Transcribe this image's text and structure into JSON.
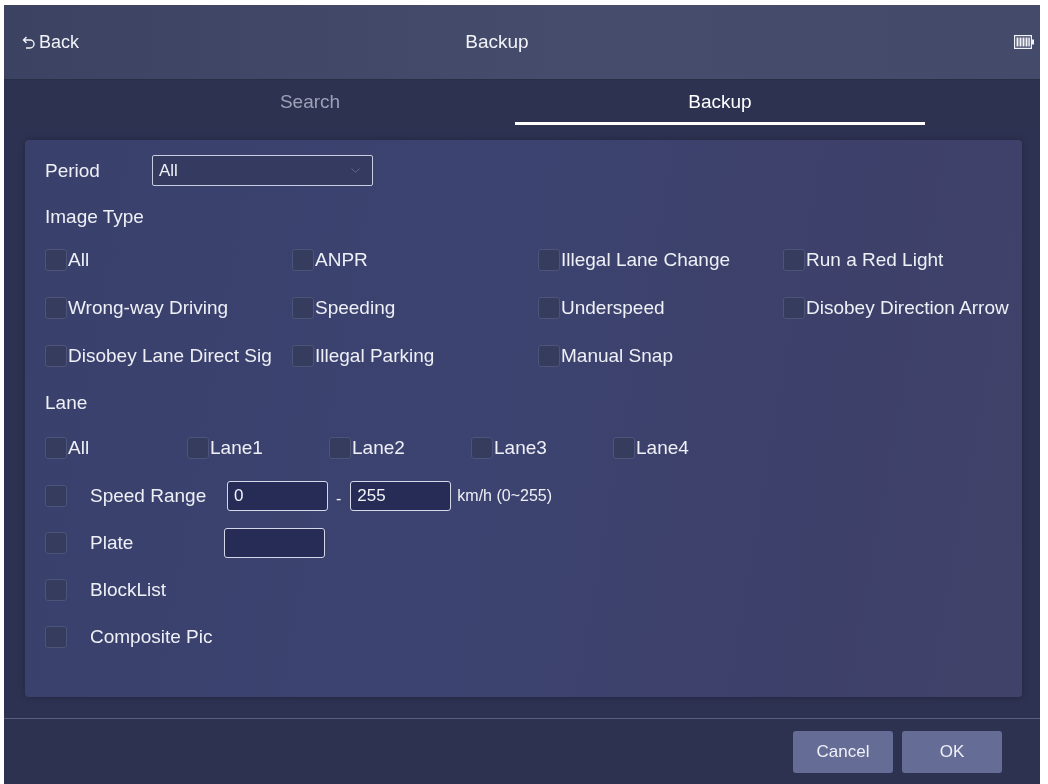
{
  "header": {
    "back_label": "Back",
    "title": "Backup"
  },
  "tabs": [
    {
      "label": "Search",
      "selected": false
    },
    {
      "label": "Backup",
      "selected": true
    }
  ],
  "period": {
    "label": "Period",
    "value": "All"
  },
  "image_type": {
    "label": "Image Type",
    "options": [
      {
        "label": "All",
        "checked": false
      },
      {
        "label": "ANPR",
        "checked": false
      },
      {
        "label": "Illegal Lane Change",
        "checked": false
      },
      {
        "label": "Run a Red Light",
        "checked": false
      },
      {
        "label": "Wrong-way Driving",
        "checked": false
      },
      {
        "label": "Speeding",
        "checked": false
      },
      {
        "label": "Underspeed",
        "checked": false
      },
      {
        "label": "Disobey Direction Arrow",
        "checked": false
      },
      {
        "label": "Disobey Lane Direct Sig",
        "checked": false
      },
      {
        "label": "Illegal Parking",
        "checked": false
      },
      {
        "label": "Manual Snap",
        "checked": false
      }
    ]
  },
  "lane": {
    "label": "Lane",
    "options": [
      {
        "label": "All",
        "checked": false
      },
      {
        "label": "Lane1",
        "checked": false
      },
      {
        "label": "Lane2",
        "checked": false
      },
      {
        "label": "Lane3",
        "checked": false
      },
      {
        "label": "Lane4",
        "checked": false
      }
    ]
  },
  "filters": [
    {
      "kind": "range",
      "label": "Speed Range",
      "checked": false,
      "from": "0",
      "separator": "-",
      "to": "255",
      "unit": "km/h (0~255)"
    },
    {
      "kind": "text",
      "label": "Plate",
      "checked": false
    },
    {
      "kind": "plain",
      "label": "BlockList",
      "checked": false
    },
    {
      "kind": "plain",
      "label": "Composite Pic",
      "checked": false
    }
  ],
  "buttons": [
    "Cancel",
    "OK"
  ]
}
